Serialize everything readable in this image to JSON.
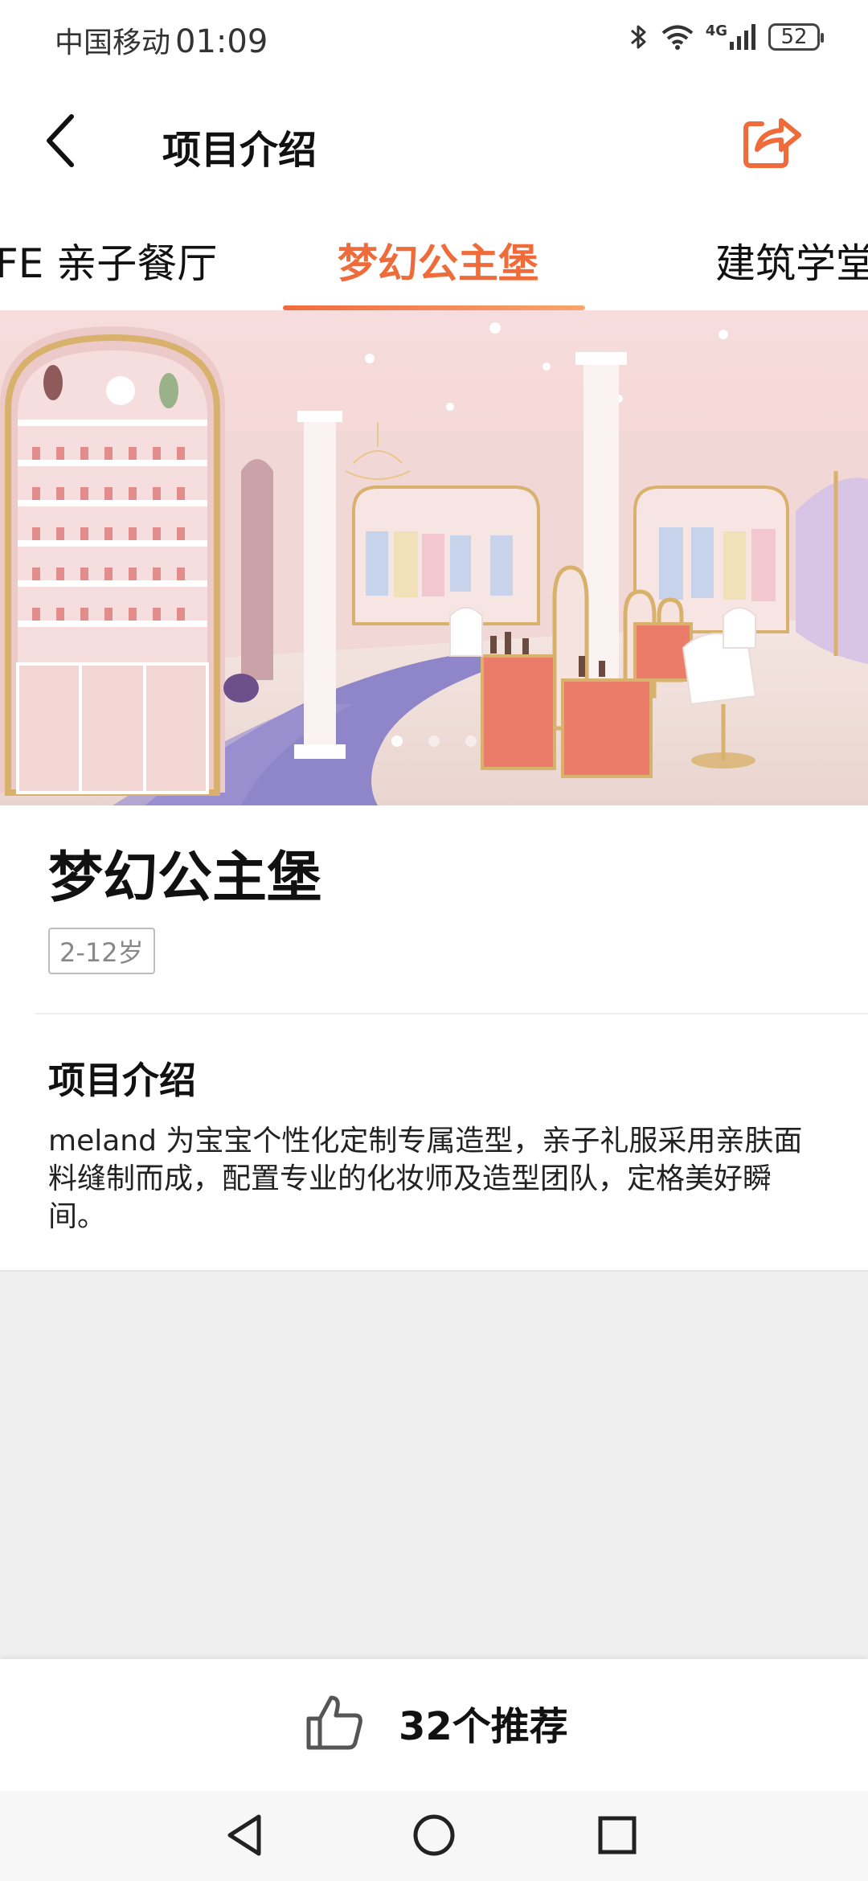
{
  "status_bar": {
    "carrier": "中国移动",
    "time": "01:09",
    "network": "4G",
    "battery": "52",
    "icons": [
      "bluetooth-icon",
      "wifi-icon",
      "signal-icon",
      "battery-icon"
    ]
  },
  "nav": {
    "title": "项目介绍",
    "back_icon": "chevron-left-icon",
    "share_icon": "share-icon"
  },
  "tabs": [
    {
      "label": "FE 亲子餐厅",
      "active": false
    },
    {
      "label": "梦幻公主堡",
      "active": true
    },
    {
      "label": "建筑学堂",
      "active": false
    }
  ],
  "hero": {
    "carousel_total": 3,
    "carousel_active": 1
  },
  "item": {
    "title": "梦幻公主堡",
    "age_tag": "2-12岁"
  },
  "intro": {
    "heading": "项目介绍",
    "body": "meland 为宝宝个性化定制专属造型，亲子礼服采用亲肤面料缝制而成，配置专业的化妆师及造型团队，定格美好瞬间。"
  },
  "bottom": {
    "recommend_label": "32个推荐",
    "thumb_icon": "thumbs-up-icon"
  },
  "system_nav": [
    "back-triangle-icon",
    "home-circle-icon",
    "recent-square-icon"
  ],
  "colors": {
    "accent": "#f06b3a",
    "background_gray": "#efefef"
  }
}
